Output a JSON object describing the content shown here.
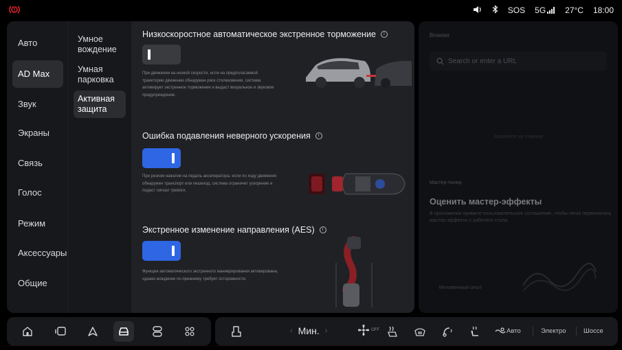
{
  "status_bar": {
    "alert_icon": "brake-warning-icon",
    "volume_icon": "volume-icon",
    "bluetooth_icon": "bluetooth-icon",
    "sos": "SOS",
    "network": "5G",
    "temperature": "27°C",
    "time": "18:00",
    "alert_color": "#d8242b"
  },
  "nav_primary": [
    {
      "label": "Авто"
    },
    {
      "label": "AD Max"
    },
    {
      "label": "Звук"
    },
    {
      "label": "Экраны"
    },
    {
      "label": "Связь"
    },
    {
      "label": "Голос"
    },
    {
      "label": "Режим"
    },
    {
      "label": "Аксессуары"
    },
    {
      "label": "Общие"
    }
  ],
  "nav_primary_active": "AD Max",
  "nav_secondary": [
    {
      "label": "Умное вождение"
    },
    {
      "label": "Умная парковка"
    },
    {
      "label": "Активная защита"
    }
  ],
  "nav_secondary_active": "Активная защита",
  "sections": [
    {
      "title": "Низкоскоростное автоматическое экстренное торможение",
      "enabled": false,
      "description": "При движении на низкой скорости, если на предполагаемой траектории движения обнаружен риск столкновения, система активирует экстренное торможение и выдаст визуальное и звуковое предупреждение."
    },
    {
      "title": "Ошибка подавления неверного ускорения",
      "enabled": true,
      "description": "При резком нажатии на педаль акселератора, если по ходу движения обнаружен транспорт или пешеход, система ограничит ускорение и подаст сигнал тревоги."
    },
    {
      "title": "Экстренное изменение направления (AES)",
      "enabled": true,
      "description": "Функция автоматического экстренного маневрирования активирована, однако вождение по-прежнему требует осторожности."
    }
  ],
  "right_panel": {
    "header": "Browser",
    "search_placeholder": "Search or enter a URL",
    "faint_line": "Закрепите на главном",
    "caption": "Мастер-тюнер",
    "title": "Оценить мастер-эффекты",
    "description": "В приложении примите пользовательское соглашение, чтобы легко переключать мастер-эффекты с рабочего стола.",
    "bottom_label": "Мгновенный опыт"
  },
  "dock": {
    "left_icons": [
      "home-icon",
      "screen-switch-icon",
      "navigation-icon",
      "car-icon",
      "vehicle-control-icon",
      "apps-grid-icon"
    ],
    "active_icon": "car-icon",
    "seat_icon": "seat-icon",
    "temperature": "Мин.",
    "fan_label": "OFF",
    "modes": [
      "Авто",
      "Электро",
      "Шоссе"
    ]
  },
  "colors": {
    "accent": "#2f66e4",
    "panel": "#141518",
    "content": "#202125",
    "active_item": "#2c2d31"
  }
}
